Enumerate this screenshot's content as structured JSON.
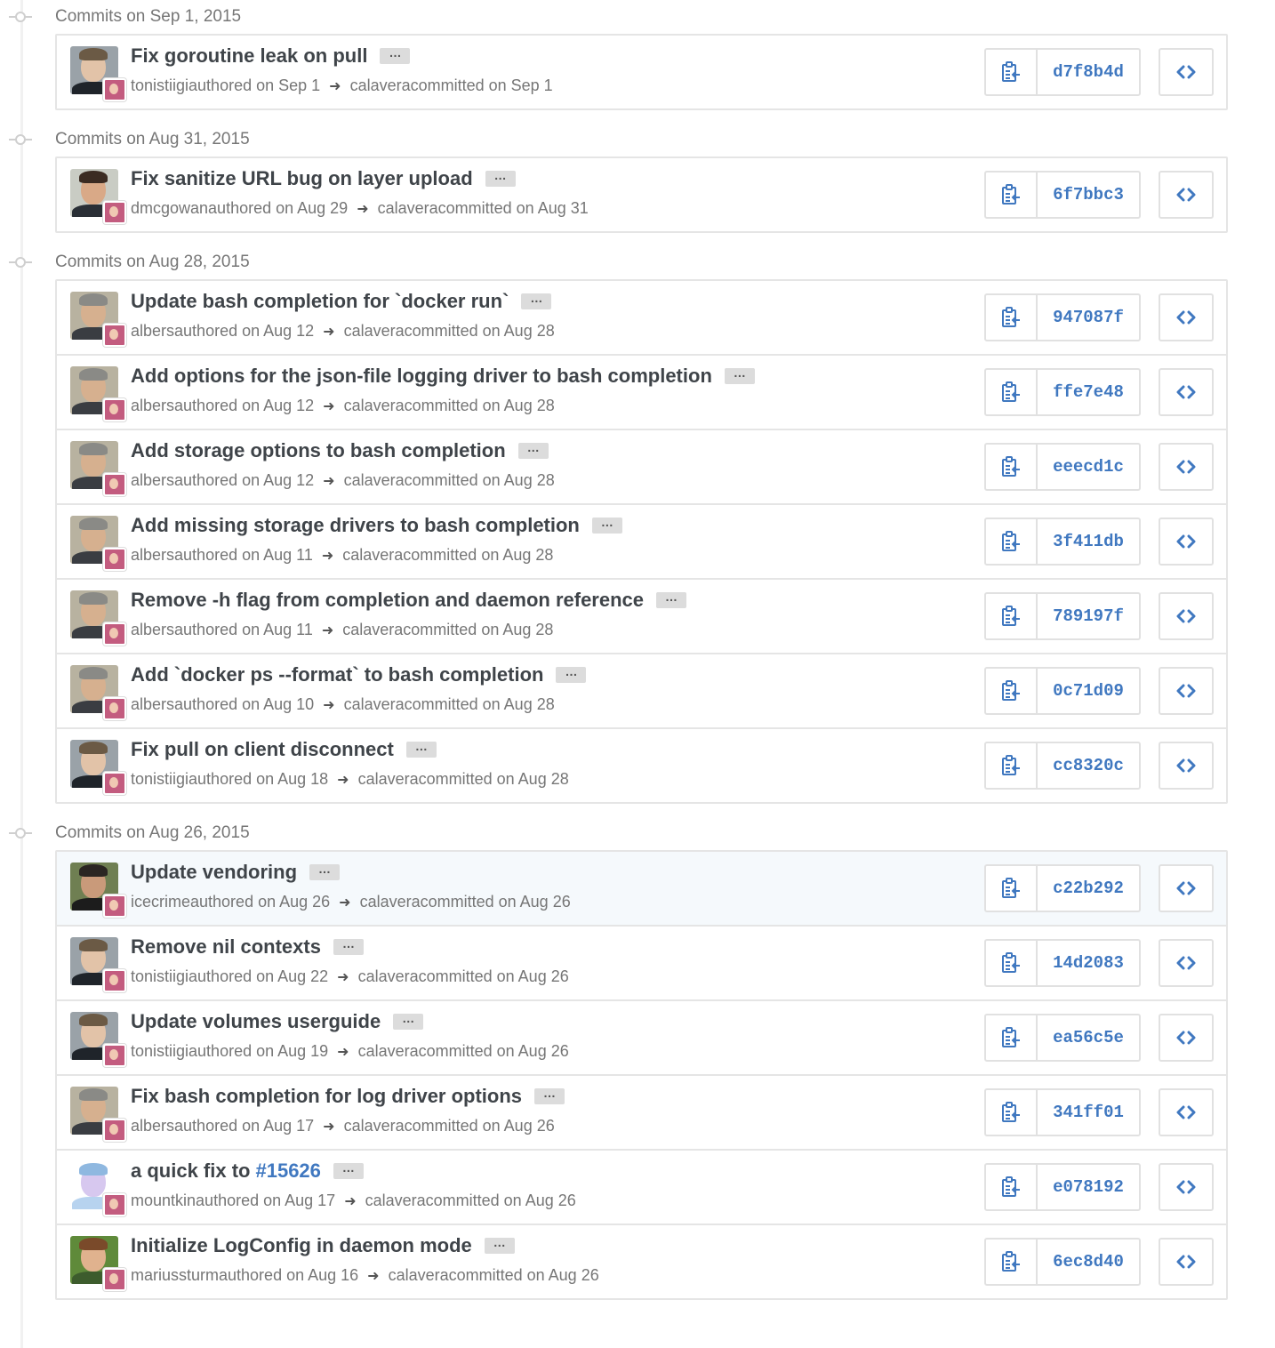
{
  "day_groups": [
    {
      "header": "Commits on Sep 1, 2015",
      "commits": [
        {
          "title": "Fix goroutine leak on pull",
          "author": "tonistiigi",
          "authored": "authored on Sep 1",
          "committer": "calavera",
          "committed": "committed on Sep 1",
          "sha": "d7f8b4d",
          "avatar": "tonistiigi"
        }
      ]
    },
    {
      "header": "Commits on Aug 31, 2015",
      "commits": [
        {
          "title": "Fix sanitize URL bug on layer upload",
          "author": "dmcgowan",
          "authored": "authored on Aug 29",
          "committer": "calavera",
          "committed": "committed on Aug 31",
          "sha": "6f7bbc3",
          "avatar": "dmcgowan"
        }
      ]
    },
    {
      "header": "Commits on Aug 28, 2015",
      "commits": [
        {
          "title": "Update bash completion for `docker run`",
          "author": "albers",
          "authored": "authored on Aug 12",
          "committer": "calavera",
          "committed": "committed on Aug 28",
          "sha": "947087f",
          "avatar": "albers"
        },
        {
          "title": "Add options for the json-file logging driver to bash completion",
          "author": "albers",
          "authored": "authored on Aug 12",
          "committer": "calavera",
          "committed": "committed on Aug 28",
          "sha": "ffe7e48",
          "avatar": "albers"
        },
        {
          "title": "Add storage options to bash completion",
          "author": "albers",
          "authored": "authored on Aug 12",
          "committer": "calavera",
          "committed": "committed on Aug 28",
          "sha": "eeecd1c",
          "avatar": "albers"
        },
        {
          "title": "Add missing storage drivers to bash completion",
          "author": "albers",
          "authored": "authored on Aug 11",
          "committer": "calavera",
          "committed": "committed on Aug 28",
          "sha": "3f411db",
          "avatar": "albers"
        },
        {
          "title": "Remove -h flag from completion and daemon reference",
          "author": "albers",
          "authored": "authored on Aug 11",
          "committer": "calavera",
          "committed": "committed on Aug 28",
          "sha": "789197f",
          "avatar": "albers"
        },
        {
          "title": "Add `docker ps --format` to bash completion",
          "author": "albers",
          "authored": "authored on Aug 10",
          "committer": "calavera",
          "committed": "committed on Aug 28",
          "sha": "0c71d09",
          "avatar": "albers"
        },
        {
          "title": "Fix pull on client disconnect",
          "author": "tonistiigi",
          "authored": "authored on Aug 18",
          "committer": "calavera",
          "committed": "committed on Aug 28",
          "sha": "cc8320c",
          "avatar": "tonistiigi"
        }
      ]
    },
    {
      "header": "Commits on Aug 26, 2015",
      "commits": [
        {
          "title": "Update vendoring",
          "author": "icecrime",
          "authored": "authored on Aug 26",
          "committer": "calavera",
          "committed": "committed on Aug 26",
          "sha": "c22b292",
          "avatar": "icecrime",
          "highlight": true
        },
        {
          "title": "Remove nil contexts",
          "author": "tonistiigi",
          "authored": "authored on Aug 22",
          "committer": "calavera",
          "committed": "committed on Aug 26",
          "sha": "14d2083",
          "avatar": "tonistiigi"
        },
        {
          "title": "Update volumes userguide",
          "author": "tonistiigi",
          "authored": "authored on Aug 19",
          "committer": "calavera",
          "committed": "committed on Aug 26",
          "sha": "ea56c5e",
          "avatar": "tonistiigi"
        },
        {
          "title": "Fix bash completion for log driver options",
          "author": "albers",
          "authored": "authored on Aug 17",
          "committer": "calavera",
          "committed": "committed on Aug 26",
          "sha": "341ff01",
          "avatar": "albers"
        },
        {
          "title": "a quick fix to",
          "issue_link": "#15626",
          "author": "mountkin",
          "authored": "authored on Aug 17",
          "committer": "calavera",
          "committed": "committed on Aug 26",
          "sha": "e078192",
          "avatar": "mountkin"
        },
        {
          "title": "Initialize LogConfig in daemon mode",
          "author": "mariussturm",
          "authored": "authored on Aug 16",
          "committer": "calavera",
          "committed": "committed on Aug 26",
          "sha": "6ec8d40",
          "avatar": "mariussturm"
        }
      ]
    }
  ],
  "ellipsis_label": "…",
  "browse_label": "<>",
  "icons": {
    "copy": "clipboard-icon",
    "arrow": "arrow-right-icon",
    "timeline_node": "commit-node-icon",
    "browse": "code-icon"
  },
  "colors": {
    "link": "#4078c0",
    "title": "#3f4449",
    "meta": "#767676",
    "border": "#e5e5e5",
    "highlight_row": "#f5f9fc"
  }
}
